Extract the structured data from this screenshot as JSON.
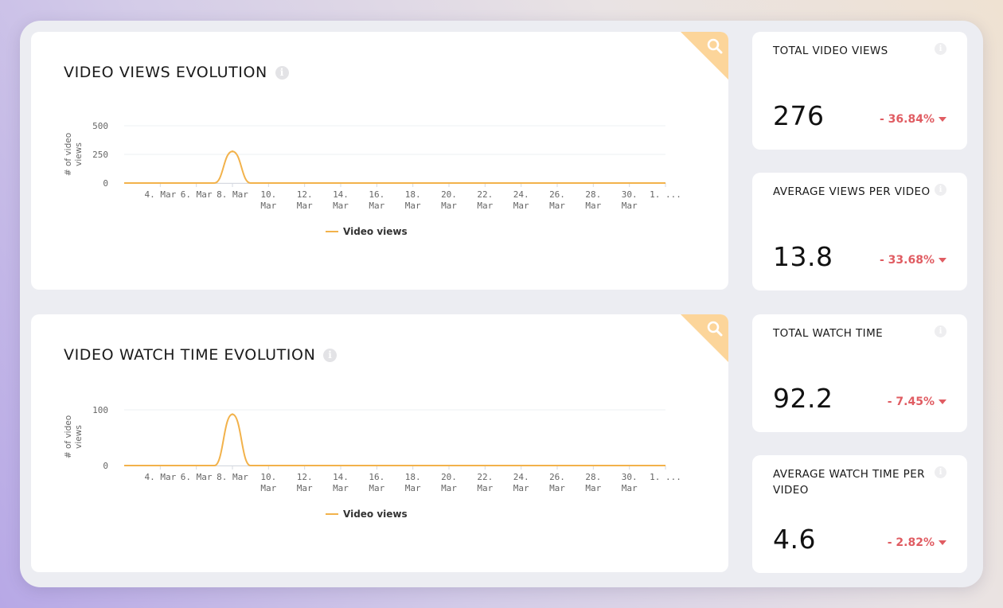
{
  "colors": {
    "accent": "#f2b24b",
    "corner": "#fcd59a",
    "negative": "#e05c62"
  },
  "charts": [
    {
      "title": "VIDEO VIEWS EVOLUTION",
      "info_icon": "info-icon",
      "corner_icon": "search-icon",
      "legend": "Video views",
      "chart_data": {
        "type": "line",
        "title": "VIDEO VIEWS EVOLUTION",
        "ylabel": "# of video views",
        "xlabel": "",
        "ylim": [
          0,
          500
        ],
        "yticks": [
          0,
          250,
          500
        ],
        "x_tick_labels": [
          "4. Mar",
          "6. Mar",
          "8. Mar",
          "10. Mar",
          "12. Mar",
          "14. Mar",
          "16. Mar",
          "18. Mar",
          "20. Mar",
          "22. Mar",
          "24. Mar",
          "26. Mar",
          "28. Mar",
          "30. Mar",
          "1. ..."
        ],
        "series": [
          {
            "name": "Video views",
            "x": [
              "2 Mar",
              "3 Mar",
              "4 Mar",
              "5 Mar",
              "6 Mar",
              "7 Mar",
              "8 Mar",
              "9 Mar",
              "10 Mar",
              "11 Mar",
              "12 Mar",
              "13 Mar",
              "14 Mar",
              "15 Mar",
              "16 Mar",
              "17 Mar",
              "18 Mar",
              "19 Mar",
              "20 Mar",
              "21 Mar",
              "22 Mar",
              "23 Mar",
              "24 Mar",
              "25 Mar",
              "26 Mar",
              "27 Mar",
              "28 Mar",
              "29 Mar",
              "30 Mar",
              "31 Mar",
              "1 Apr"
            ],
            "values": [
              0,
              0,
              0,
              0,
              0,
              0,
              276,
              0,
              0,
              0,
              0,
              0,
              0,
              0,
              0,
              0,
              0,
              0,
              0,
              0,
              0,
              0,
              0,
              0,
              0,
              0,
              0,
              0,
              0,
              0,
              0
            ]
          }
        ],
        "grid": true,
        "legend_position": "bottom"
      }
    },
    {
      "title": "VIDEO WATCH TIME EVOLUTION",
      "info_icon": "info-icon",
      "corner_icon": "search-icon",
      "legend": "Video views",
      "chart_data": {
        "type": "line",
        "title": "VIDEO WATCH TIME EVOLUTION",
        "ylabel": "# of video views",
        "xlabel": "",
        "ylim": [
          0,
          100
        ],
        "yticks": [
          0,
          100
        ],
        "x_tick_labels": [
          "4. Mar",
          "6. Mar",
          "8. Mar",
          "10. Mar",
          "12. Mar",
          "14. Mar",
          "16. Mar",
          "18. Mar",
          "20. Mar",
          "22. Mar",
          "24. Mar",
          "26. Mar",
          "28. Mar",
          "30. Mar",
          "1. ..."
        ],
        "series": [
          {
            "name": "Video views",
            "x": [
              "2 Mar",
              "3 Mar",
              "4 Mar",
              "5 Mar",
              "6 Mar",
              "7 Mar",
              "8 Mar",
              "9 Mar",
              "10 Mar",
              "11 Mar",
              "12 Mar",
              "13 Mar",
              "14 Mar",
              "15 Mar",
              "16 Mar",
              "17 Mar",
              "18 Mar",
              "19 Mar",
              "20 Mar",
              "21 Mar",
              "22 Mar",
              "23 Mar",
              "24 Mar",
              "25 Mar",
              "26 Mar",
              "27 Mar",
              "28 Mar",
              "29 Mar",
              "30 Mar",
              "31 Mar",
              "1 Apr"
            ],
            "values": [
              0,
              0,
              0,
              0,
              0,
              0,
              92,
              0,
              0,
              0,
              0,
              0,
              0,
              0,
              0,
              0,
              0,
              0,
              0,
              0,
              0,
              0,
              0,
              0,
              0,
              0,
              0,
              0,
              0,
              0,
              0
            ]
          }
        ],
        "grid": true,
        "legend_position": "bottom"
      }
    }
  ],
  "kpis": [
    {
      "label": "TOTAL VIDEO VIEWS",
      "value": "276",
      "change": "- 36.84%",
      "info_icon": "info-icon",
      "trend_icon": "caret-down-icon"
    },
    {
      "label": "AVERAGE VIEWS PER VIDEO",
      "value": "13.8",
      "change": "- 33.68%",
      "info_icon": "info-icon",
      "trend_icon": "caret-down-icon"
    },
    {
      "label": "TOTAL WATCH TIME",
      "value": "92.2",
      "change": "- 7.45%",
      "info_icon": "info-icon",
      "trend_icon": "caret-down-icon"
    },
    {
      "label": "AVERAGE WATCH TIME PER VIDEO",
      "value": "4.6",
      "change": "- 2.82%",
      "info_icon": "info-icon",
      "trend_icon": "caret-down-icon"
    }
  ]
}
